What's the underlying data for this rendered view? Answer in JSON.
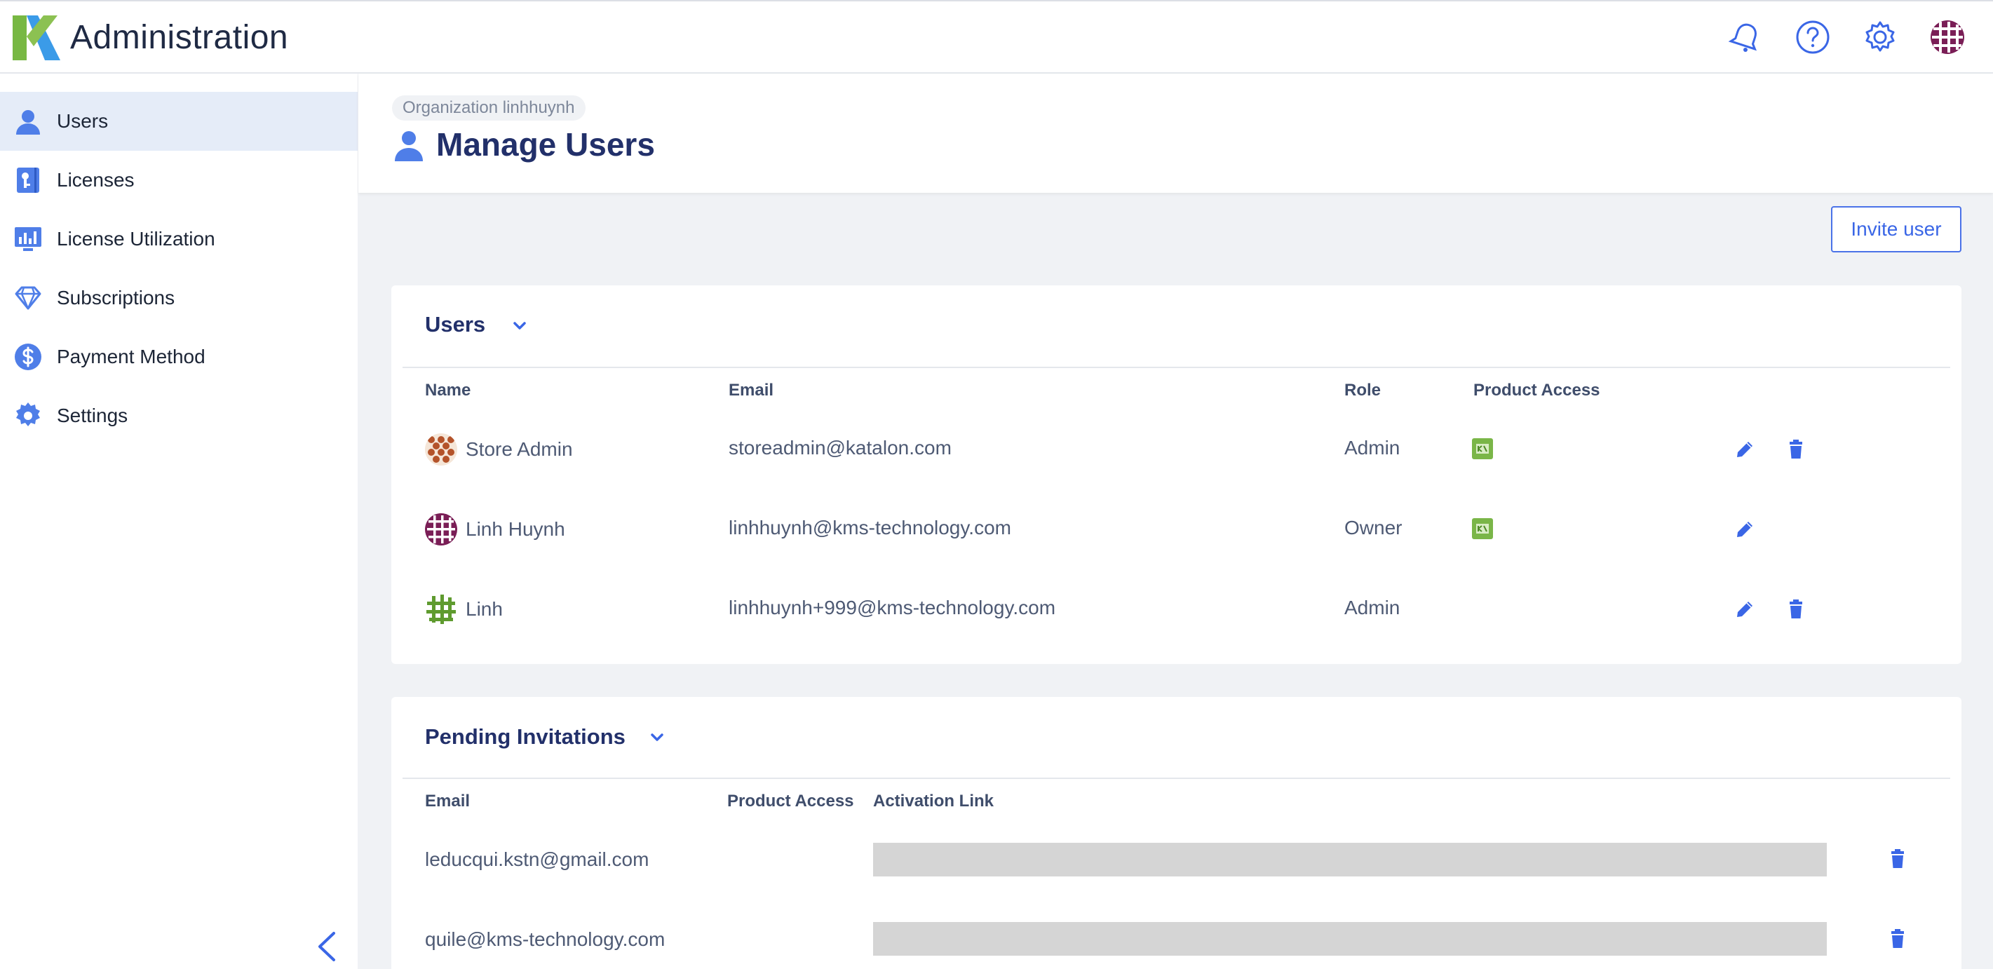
{
  "app": {
    "title": "Administration"
  },
  "topbar": {
    "icons": [
      "bell-icon",
      "help-icon",
      "gear-icon",
      "avatar"
    ]
  },
  "sidebar": {
    "items": [
      {
        "label": "Users",
        "icon": "user-icon",
        "active": true
      },
      {
        "label": "Licenses",
        "icon": "license-icon",
        "active": false
      },
      {
        "label": "License Utilization",
        "icon": "chart-icon",
        "active": false
      },
      {
        "label": "Subscriptions",
        "icon": "diamond-icon",
        "active": false
      },
      {
        "label": "Payment Method",
        "icon": "dollar-icon",
        "active": false
      },
      {
        "label": "Settings",
        "icon": "gear-icon",
        "active": false
      }
    ]
  },
  "header": {
    "org": "Organization linhhuynh",
    "title": "Manage Users"
  },
  "actions": {
    "invite_label": "Invite user"
  },
  "users": {
    "title": "Users",
    "columns": {
      "name": "Name",
      "email": "Email",
      "role": "Role",
      "product_access": "Product Access"
    },
    "rows": [
      {
        "name": "Store Admin",
        "email": "storeadmin@katalon.com",
        "role": "Admin",
        "has_product": true,
        "can_delete": true
      },
      {
        "name": "Linh Huynh",
        "email": "linhhuynh@kms-technology.com",
        "role": "Owner",
        "has_product": true,
        "can_delete": false
      },
      {
        "name": "Linh",
        "email": "linhhuynh+999@kms-technology.com",
        "role": "Admin",
        "has_product": false,
        "can_delete": true
      }
    ]
  },
  "pending": {
    "title": "Pending Invitations",
    "columns": {
      "email": "Email",
      "product_access": "Product Access",
      "activation_link": "Activation Link"
    },
    "rows": [
      {
        "email": "leducqui.kstn@gmail.com"
      },
      {
        "email": "quile@kms-technology.com"
      }
    ]
  },
  "colors": {
    "accent": "#3a66e6",
    "title": "#22306a",
    "active_bg": "#e5ecf8",
    "product_green": "#7ab648"
  }
}
